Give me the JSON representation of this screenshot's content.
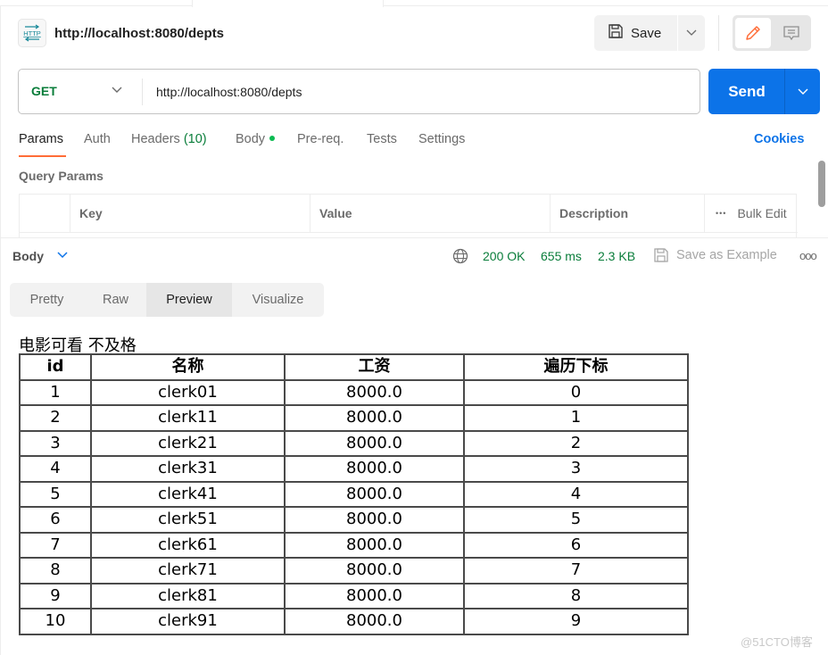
{
  "request": {
    "title": "http://localhost:8080/depts",
    "method": "GET",
    "url": "http://localhost:8080/depts",
    "save_label": "Save",
    "send_label": "Send"
  },
  "request_tabs": [
    {
      "label": "Params",
      "active": true
    },
    {
      "label": "Auth"
    },
    {
      "label": "Headers",
      "count": "(10)"
    },
    {
      "label": "Body",
      "has_dot": true
    },
    {
      "label": "Pre-req."
    },
    {
      "label": "Tests"
    },
    {
      "label": "Settings"
    }
  ],
  "cookies_label": "Cookies",
  "query_params": {
    "section_label": "Query Params",
    "columns": [
      "Key",
      "Value",
      "Description"
    ],
    "bulk_edit_label": "Bulk Edit",
    "more_icon": "•••"
  },
  "response": {
    "label": "Body",
    "status": "200 OK",
    "time": "655 ms",
    "size": "2.3 KB",
    "save_example_label": "Save as Example",
    "more_icon": "ooo",
    "view_tabs": [
      {
        "label": "Pretty"
      },
      {
        "label": "Raw"
      },
      {
        "label": "Preview",
        "active": true
      },
      {
        "label": "Visualize"
      }
    ]
  },
  "preview": {
    "heading": "电影可看 不及格",
    "columns": [
      "id",
      "名称",
      "工资",
      "遍历下标"
    ],
    "rows": [
      [
        "1",
        "clerk01",
        "8000.0",
        "0"
      ],
      [
        "2",
        "clerk11",
        "8000.0",
        "1"
      ],
      [
        "3",
        "clerk21",
        "8000.0",
        "2"
      ],
      [
        "4",
        "clerk31",
        "8000.0",
        "3"
      ],
      [
        "5",
        "clerk41",
        "8000.0",
        "4"
      ],
      [
        "6",
        "clerk51",
        "8000.0",
        "5"
      ],
      [
        "7",
        "clerk61",
        "8000.0",
        "6"
      ],
      [
        "8",
        "clerk71",
        "8000.0",
        "7"
      ],
      [
        "9",
        "clerk81",
        "8000.0",
        "8"
      ],
      [
        "10",
        "clerk91",
        "8000.0",
        "9"
      ]
    ]
  },
  "watermark": "@51CTO博客",
  "colors": {
    "accent": "#ff6c37",
    "send": "#0c73e8",
    "success": "#097d3a",
    "link": "#0c73e8"
  }
}
